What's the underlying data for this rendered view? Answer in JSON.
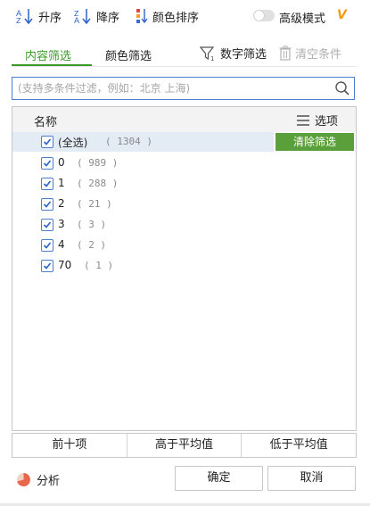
{
  "toolbar": {
    "sort_asc": "升序",
    "sort_desc": "降序",
    "color_sort": "颜色排序",
    "advanced_mode": "高级模式",
    "advanced_badge": "V",
    "advanced_enabled": false
  },
  "tabs": {
    "content_filter": "内容筛选",
    "color_filter": "颜色筛选",
    "number_filter": "数字筛选",
    "clear_conditions": "清空条件"
  },
  "search": {
    "value": "",
    "placeholder": "(支持多条件过滤，例如：北京 上海)"
  },
  "list": {
    "header_name": "名称",
    "header_options": "选项",
    "clear_filter": "清除筛选",
    "items": [
      {
        "label": "(全选)",
        "count": "( 1304 )",
        "checked": true
      },
      {
        "label": "0",
        "count": "( 989 )",
        "checked": true
      },
      {
        "label": "1",
        "count": "( 288 )",
        "checked": true
      },
      {
        "label": "2",
        "count": "( 21 )",
        "checked": true
      },
      {
        "label": "3",
        "count": "( 3 )",
        "checked": true
      },
      {
        "label": "4",
        "count": "( 2 )",
        "checked": true
      },
      {
        "label": "70",
        "count": "( 1 )",
        "checked": true
      }
    ]
  },
  "quick": {
    "top10": "前十项",
    "above_avg": "高于平均值",
    "below_avg": "低于平均值"
  },
  "footer": {
    "analysis": "分析",
    "ok": "确定",
    "cancel": "取消"
  },
  "colors": {
    "accent_green": "#5aa03a",
    "tab_green": "#3d9a2b",
    "accent_blue": "#4a7fd2",
    "badge_orange": "#f39c12"
  }
}
